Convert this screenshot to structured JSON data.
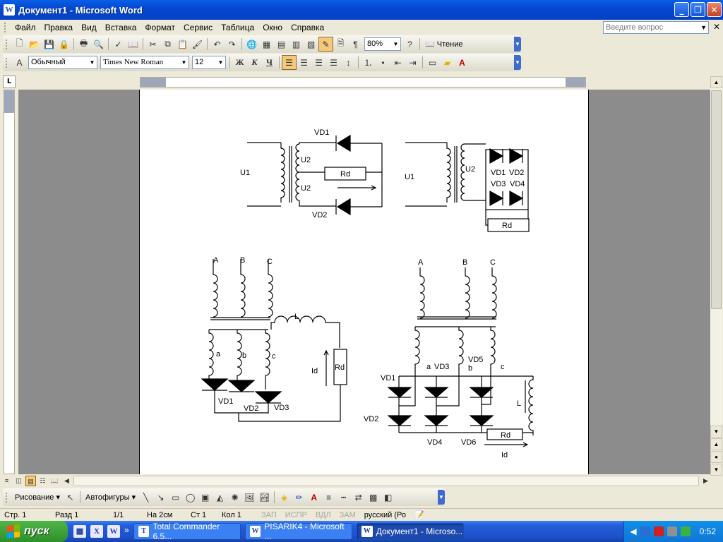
{
  "window": {
    "title": "Документ1 - Microsoft Word"
  },
  "menu": {
    "items": [
      "Файл",
      "Правка",
      "Вид",
      "Вставка",
      "Формат",
      "Сервис",
      "Таблица",
      "Окно",
      "Справка"
    ],
    "ask_placeholder": "Введите вопрос"
  },
  "toolbar": {
    "zoom": "80%",
    "read_label": "Чтение"
  },
  "format": {
    "style": "Обычный",
    "font": "Times New Roman",
    "size": "12"
  },
  "circuits": {
    "c1": {
      "vd1": "VD1",
      "vd2": "VD2",
      "u1": "U1",
      "u2a": "U2",
      "u2b": "U2",
      "rd": "Rd"
    },
    "c2": {
      "u1": "U1",
      "u2": "U2",
      "vd1": "VD1",
      "vd2": "VD2",
      "vd3": "VD3",
      "vd4": "VD4",
      "rd": "Rd"
    },
    "c3": {
      "a": "A",
      "b": "B",
      "c": "C",
      "wa": "a",
      "wb": "b",
      "wc": "c",
      "l": "L",
      "id": "Id",
      "rd": "Rd",
      "vd1": "VD1",
      "vd2": "VD2",
      "vd3": "VD3"
    },
    "c4": {
      "a": "A",
      "b": "B",
      "c": "C",
      "wa": "a",
      "wb": "b",
      "wc": "c",
      "vd1": "VD1",
      "vd2": "VD2",
      "vd3": "VD3",
      "vd4": "VD4",
      "vd5": "VD5",
      "vd6": "VD6",
      "l": "L",
      "rd": "Rd",
      "id": "Id"
    }
  },
  "drawing": {
    "draw_label": "Рисование",
    "autoshapes_label": "Автофигуры"
  },
  "status": {
    "page": "Стр. 1",
    "section": "Разд 1",
    "pages": "1/1",
    "at": "На 2см",
    "line": "Ст 1",
    "col": "Кол 1",
    "rec": "ЗАП",
    "trk": "ИСПР",
    "ext": "ВДЛ",
    "ovr": "ЗАМ",
    "lang": "русский (Ро"
  },
  "taskbar": {
    "start": "пуск",
    "tasks": [
      "Total Commander 6.5...",
      "PISARIK4 - Microsoft ...",
      "Документ1 - Microso..."
    ],
    "time": "0:52"
  }
}
